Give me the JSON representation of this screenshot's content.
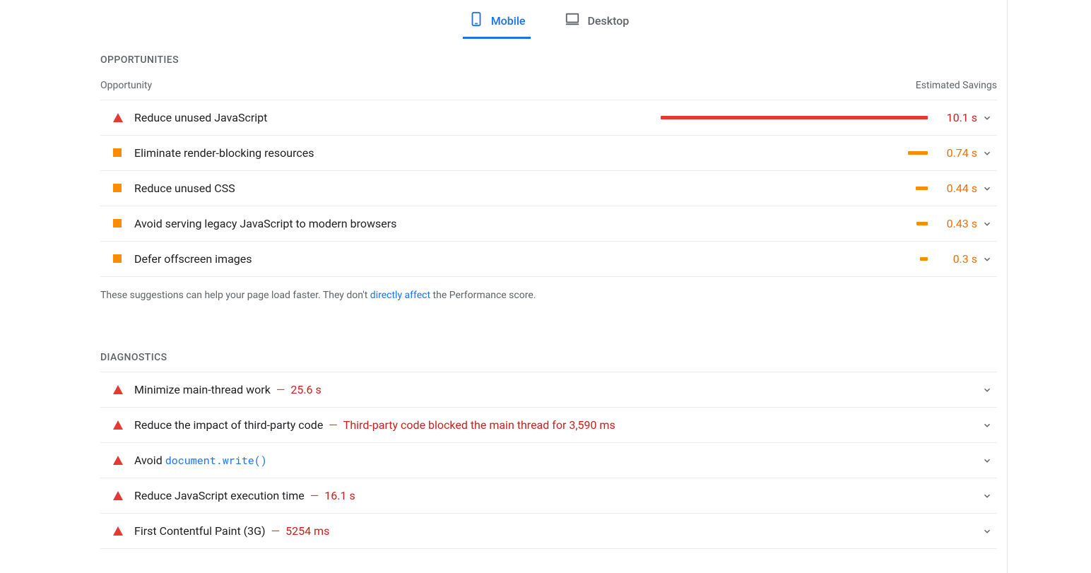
{
  "tabs": {
    "mobile": "Mobile",
    "desktop": "Desktop"
  },
  "opportunities": {
    "heading": "Opportunities",
    "col_opportunity": "Opportunity",
    "col_savings": "Estimated Savings",
    "rows": [
      {
        "severity": "red",
        "title": "Reduce unused JavaScript",
        "bar_pct": 100,
        "savings": "10.1 s"
      },
      {
        "severity": "orange",
        "title": "Eliminate render-blocking resources",
        "bar_pct": 7.3,
        "savings": "0.74 s"
      },
      {
        "severity": "orange",
        "title": "Reduce unused CSS",
        "bar_pct": 4.4,
        "savings": "0.44 s"
      },
      {
        "severity": "orange",
        "title": "Avoid serving legacy JavaScript to modern browsers",
        "bar_pct": 4.3,
        "savings": "0.43 s"
      },
      {
        "severity": "orange",
        "title": "Defer offscreen images",
        "bar_pct": 3.0,
        "savings": "0.3 s"
      }
    ],
    "footer_pre": "These suggestions can help your page load faster. They don't ",
    "footer_link": "directly affect",
    "footer_post": " the Performance score."
  },
  "diagnostics": {
    "heading": "Diagnostics",
    "rows": [
      {
        "severity": "red",
        "title": "Minimize main-thread work",
        "value": "25.6 s"
      },
      {
        "severity": "red",
        "title": "Reduce the impact of third-party code",
        "value": "Third-party code blocked the main thread for 3,590 ms"
      },
      {
        "severity": "red",
        "title": "Avoid ",
        "code": "document.write()",
        "value": ""
      },
      {
        "severity": "red",
        "title": "Reduce JavaScript execution time",
        "value": "16.1 s"
      },
      {
        "severity": "red",
        "title": "First Contentful Paint (3G)",
        "value": "5254 ms"
      }
    ]
  }
}
